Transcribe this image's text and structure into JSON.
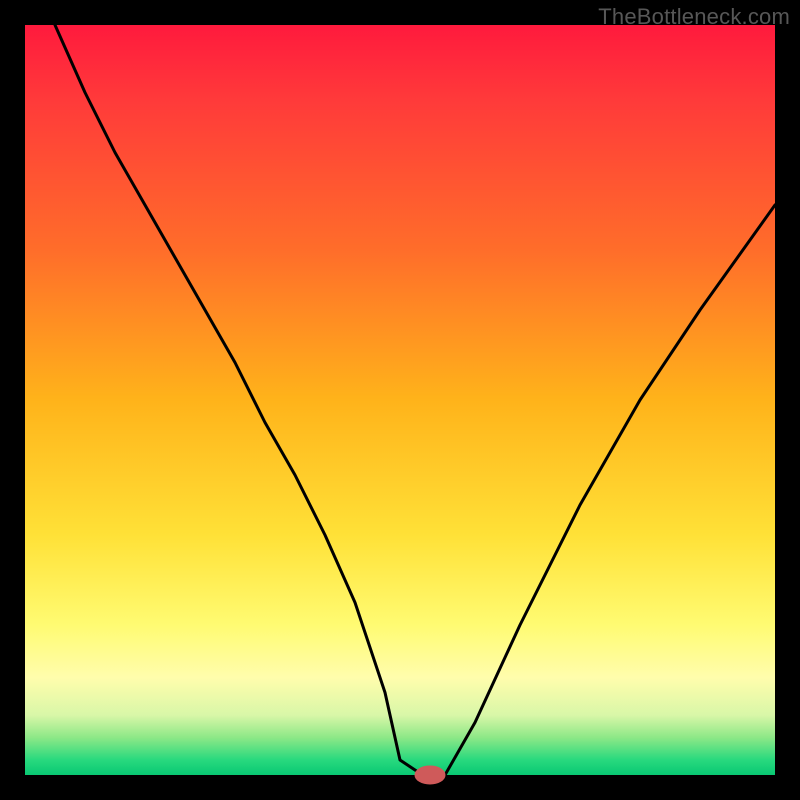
{
  "watermark": "TheBottleneck.com",
  "chart_data": {
    "type": "line",
    "title": "",
    "xlabel": "",
    "ylabel": "",
    "xlim": [
      0,
      100
    ],
    "ylim": [
      0,
      100
    ],
    "grid": false,
    "legend": null,
    "gradient_stops": [
      {
        "pos": 0,
        "color": "#ff1a3d"
      },
      {
        "pos": 10,
        "color": "#ff3a3a"
      },
      {
        "pos": 30,
        "color": "#ff6d2a"
      },
      {
        "pos": 50,
        "color": "#ffb31a"
      },
      {
        "pos": 68,
        "color": "#ffe137"
      },
      {
        "pos": 80,
        "color": "#fffb72"
      },
      {
        "pos": 87,
        "color": "#fffdac"
      },
      {
        "pos": 92,
        "color": "#d9f7a8"
      },
      {
        "pos": 95,
        "color": "#8de887"
      },
      {
        "pos": 98,
        "color": "#28d97e"
      },
      {
        "pos": 100,
        "color": "#09c873"
      }
    ],
    "series": [
      {
        "name": "bottleneck-curve",
        "x": [
          4,
          8,
          12,
          16,
          20,
          24,
          28,
          32,
          36,
          40,
          44,
          48,
          50,
          53,
          56,
          60,
          66,
          74,
          82,
          90,
          100
        ],
        "y": [
          100,
          91,
          83,
          76,
          69,
          62,
          55,
          47,
          40,
          32,
          23,
          11,
          2,
          0,
          0,
          7,
          20,
          36,
          50,
          62,
          76
        ]
      }
    ],
    "marker": {
      "x": 54,
      "y": 0,
      "rx": 2,
      "ry": 1.2,
      "color": "#cf5a5a"
    }
  }
}
